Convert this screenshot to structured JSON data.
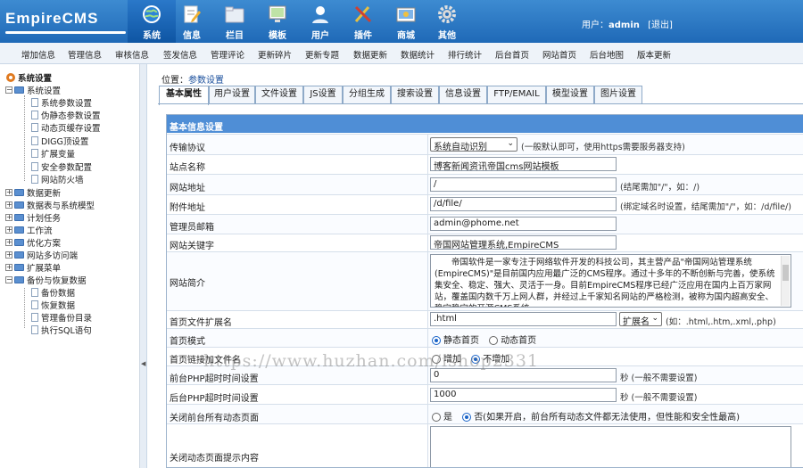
{
  "header": {
    "logo_text": "EmpireCMS",
    "nav": [
      {
        "label": "系统",
        "icon": "globe-icon",
        "active": true
      },
      {
        "label": "信息",
        "icon": "pencil-doc-icon"
      },
      {
        "label": "栏目",
        "icon": "folder-icon"
      },
      {
        "label": "模板",
        "icon": "monitor-icon"
      },
      {
        "label": "用户",
        "icon": "user-icon"
      },
      {
        "label": "插件",
        "icon": "tools-icon"
      },
      {
        "label": "商城",
        "icon": "shop-icon"
      },
      {
        "label": "其他",
        "icon": "gear-icon"
      }
    ],
    "user_prefix": "用户：",
    "username": "admin",
    "logout": "[退出]"
  },
  "submenu": [
    "增加信息",
    "管理信息",
    "审核信息",
    "签发信息",
    "管理评论",
    "更新碎片",
    "更新专题",
    "数据更新",
    "数据统计",
    "排行统计",
    "后台首页",
    "网站首页",
    "后台地图",
    "版本更新"
  ],
  "sidebar": {
    "root": "系统设置",
    "items": [
      {
        "label": "系统设置",
        "type": "folder",
        "level": 1,
        "expanded": true
      },
      {
        "label": "系统参数设置",
        "type": "doc",
        "level": 2
      },
      {
        "label": "伪静态参数设置",
        "type": "doc",
        "level": 2
      },
      {
        "label": "动态页缓存设置",
        "type": "doc",
        "level": 2
      },
      {
        "label": "DIGG顶设置",
        "type": "doc",
        "level": 2
      },
      {
        "label": "扩展变量",
        "type": "doc",
        "level": 2
      },
      {
        "label": "安全参数配置",
        "type": "doc",
        "level": 2
      },
      {
        "label": "网站防火墙",
        "type": "doc",
        "level": 2
      },
      {
        "label": "数据更新",
        "type": "folder",
        "level": 1
      },
      {
        "label": "数据表与系统模型",
        "type": "folder",
        "level": 1
      },
      {
        "label": "计划任务",
        "type": "folder",
        "level": 1
      },
      {
        "label": "工作流",
        "type": "folder",
        "level": 1
      },
      {
        "label": "优化方案",
        "type": "folder",
        "level": 1
      },
      {
        "label": "网站多访问端",
        "type": "folder",
        "level": 1
      },
      {
        "label": "扩展菜单",
        "type": "folder",
        "level": 1
      },
      {
        "label": "备份与恢复数据",
        "type": "folder",
        "level": 1,
        "expanded": true
      },
      {
        "label": "备份数据",
        "type": "doc",
        "level": 2
      },
      {
        "label": "恢复数据",
        "type": "doc",
        "level": 2
      },
      {
        "label": "管理备份目录",
        "type": "doc",
        "level": 2
      },
      {
        "label": "执行SQL语句",
        "type": "doc",
        "level": 2
      }
    ]
  },
  "location": {
    "prefix": "位置：",
    "value": "参数设置"
  },
  "tabs": [
    "基本属性",
    "用户设置",
    "文件设置",
    "JS设置",
    "分组生成",
    "搜索设置",
    "信息设置",
    "FTP/EMAIL",
    "模型设置",
    "图片设置"
  ],
  "form": {
    "section_title": "基本信息设置",
    "protocol": {
      "label": "传输协议",
      "value": "系统自动识别",
      "hint": "(一般默认即可，使用https需要服务器支持)"
    },
    "site_name": {
      "label": "站点名称",
      "value": "博客新闻资讯帝国cms网站模板"
    },
    "site_url": {
      "label": "网站地址",
      "value": "/",
      "hint": "(结尾需加\"/\"，如：/)"
    },
    "attach_url": {
      "label": "附件地址",
      "value": "/d/file/",
      "hint": "(绑定域名时设置，结尾需加\"/\"，如：/d/file/)"
    },
    "admin_email": {
      "label": "管理员邮箱",
      "value": "admin@phome.net"
    },
    "keywords": {
      "label": "网站关键字",
      "value": "帝国网站管理系统,EmpireCMS"
    },
    "intro": {
      "label": "网站简介",
      "value": "　　帝国软件是一家专注于网络软件开发的科技公司，其主营产品\"帝国网站管理系统(EmpireCMS)\"是目前国内应用最广泛的CMS程序。通过十多年的不断创新与完善，使系统集安全、稳定、强大、灵活于一身。目前EmpireCMS程序已经广泛应用在国内上百万家网站，覆盖国内数千万上网人群，并经过上千家知名网站的严格检测，被称为国内超高安全、稳定稳定的开源CMS系统。"
    },
    "index_ext": {
      "label": "首页文件扩展名",
      "value": ".html",
      "select": "扩展名",
      "hint": "(如：.html,.htm,.xml,.php)"
    },
    "index_mode": {
      "label": "首页模式",
      "options": [
        "静态首页",
        "动态首页"
      ],
      "selected": 0
    },
    "index_link_file": {
      "label": "首页链接加文件名",
      "options": [
        "增加",
        "不增加"
      ],
      "selected": 1
    },
    "front_php_timeout": {
      "label": "前台PHP超时时间设置",
      "value": "0",
      "hint": "秒 (一般不需要设置)"
    },
    "back_php_timeout": {
      "label": "后台PHP超时时间设置",
      "value": "1000",
      "hint": "秒 (一般不需要设置)"
    },
    "close_dynamic": {
      "label": "关闭前台所有动态页面",
      "options": [
        "是",
        "否(如果开启，前台所有动态文件都无法使用，但性能和安全性最高)"
      ],
      "selected": 1
    },
    "close_tip": {
      "label": "关闭动态页面提示内容",
      "value": ""
    }
  },
  "watermark": "https://www.huzhan.com/ishop2331"
}
